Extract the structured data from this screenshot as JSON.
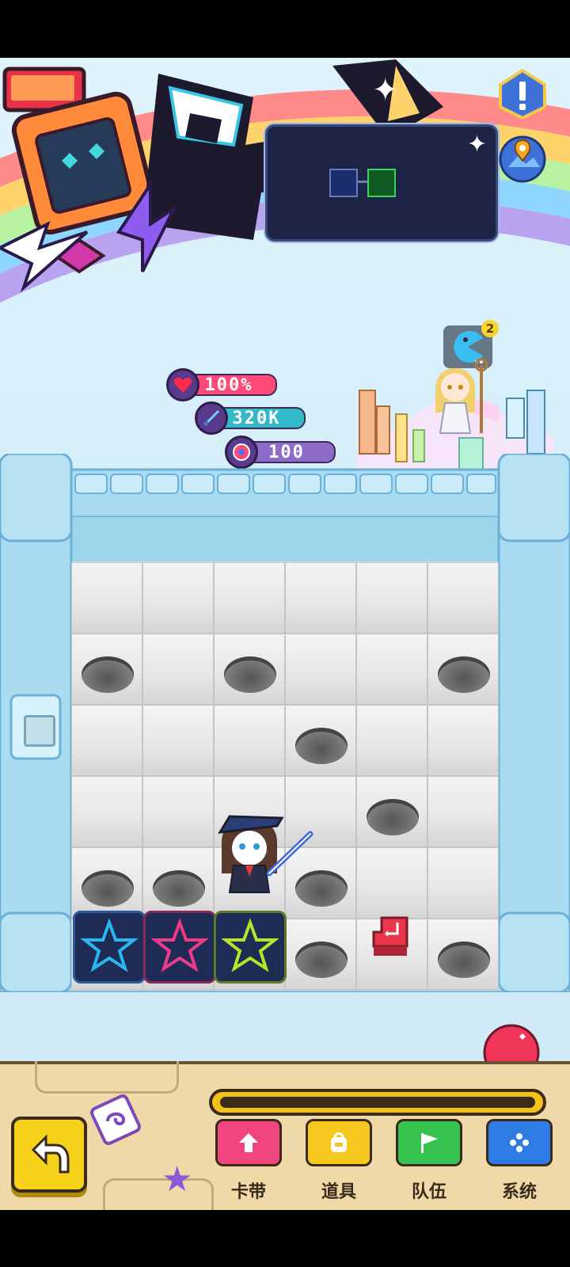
{
  "stats": {
    "hp": "100%",
    "attack": "320K",
    "coins": "100"
  },
  "notifications": {
    "avatar_badge": "2"
  },
  "minimap": {
    "rooms": [
      {
        "color": "#1d2e6e",
        "state": "visited"
      },
      {
        "color": "#0f5a23",
        "state": "current"
      }
    ]
  },
  "board": {
    "rows": 6,
    "cols": 6,
    "holes": [
      [
        1,
        0
      ],
      [
        1,
        2
      ],
      [
        1,
        5
      ],
      [
        2,
        3
      ],
      [
        3,
        4
      ],
      [
        4,
        0
      ],
      [
        4,
        1
      ],
      [
        4,
        3
      ],
      [
        5,
        3
      ],
      [
        5,
        5
      ]
    ],
    "player": {
      "row": 4,
      "col": 2
    },
    "exit": {
      "row": 5,
      "col": 4
    }
  },
  "star_cards": [
    {
      "color": "#29b7f0"
    },
    {
      "color": "#ef3a8a"
    },
    {
      "color": "#b7e32a"
    }
  ],
  "progress": {
    "fill": 0
  },
  "menu": [
    {
      "label": "卡带",
      "icon": "arrow-up-icon",
      "color": "#f0457f"
    },
    {
      "label": "道具",
      "icon": "backpack-icon",
      "color": "#f6c81d"
    },
    {
      "label": "队伍",
      "icon": "flag-icon",
      "color": "#36c24f"
    },
    {
      "label": "系统",
      "icon": "grid-dots-icon",
      "color": "#2e7de6"
    }
  ],
  "colors": {
    "hp_bar": "#ff4a78",
    "attack_bar": "#35b9c8",
    "coin_bar": "#8c6cc8",
    "back_button": "#f6d21d"
  }
}
